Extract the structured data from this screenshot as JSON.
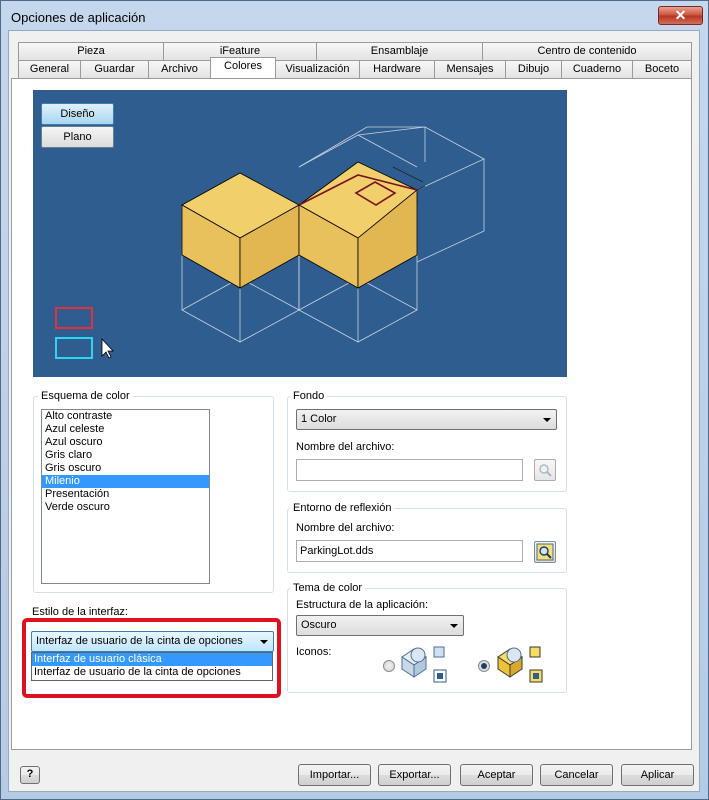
{
  "window": {
    "title": "Opciones de aplicación",
    "close_glyph": "✕"
  },
  "tabs_row1": [
    "Pieza",
    "iFeature",
    "Ensamblaje",
    "Centro de contenido"
  ],
  "tabs_row2": [
    "General",
    "Guardar",
    "Archivo",
    "Colores",
    "Visualización",
    "Hardware",
    "Mensajes",
    "Dibujo",
    "Cuaderno",
    "Boceto"
  ],
  "active_tab": "Colores",
  "preview": {
    "design_button": "Diseño",
    "flat_button": "Plano"
  },
  "color_scheme": {
    "label": "Esquema de color",
    "items": [
      "Alto contraste",
      "Azul celeste",
      "Azul oscuro",
      "Gris claro",
      "Gris oscuro",
      "Milenio",
      "Presentación",
      "Verde oscuro"
    ],
    "selected": "Milenio"
  },
  "background": {
    "label": "Fondo",
    "value": "1 Color",
    "filename_label": "Nombre del archivo:",
    "filename_value": ""
  },
  "reflection": {
    "label": "Entorno de reflexión",
    "filename_label": "Nombre del archivo:",
    "filename_value": "ParkingLot.dds"
  },
  "color_theme": {
    "label": "Tema de color",
    "structure_label": "Estructura de la aplicación:",
    "structure_value": "Oscuro",
    "icons_label": "Iconos:",
    "icons_selected": "second"
  },
  "interface_style": {
    "label": "Estilo de la interfaz:",
    "value": "Interfaz de usuario de la cinta de opciones",
    "options": [
      "Interfaz de usuario clásica",
      "Interfaz de usuario de la cinta de opciones"
    ],
    "highlighted": "Interfaz de usuario clásica"
  },
  "footer": {
    "help": "?",
    "import": "Importar...",
    "export": "Exportar...",
    "accept": "Aceptar",
    "cancel": "Cancelar",
    "apply": "Aplicar"
  },
  "colors": {
    "preview_bg": "#2f5d8f",
    "block_top": "#f1cf6b",
    "block_face": "#e9c15c",
    "block_side": "#d9aa44",
    "highlight_red": "#e0101c",
    "selection_blue": "#3399ff"
  }
}
